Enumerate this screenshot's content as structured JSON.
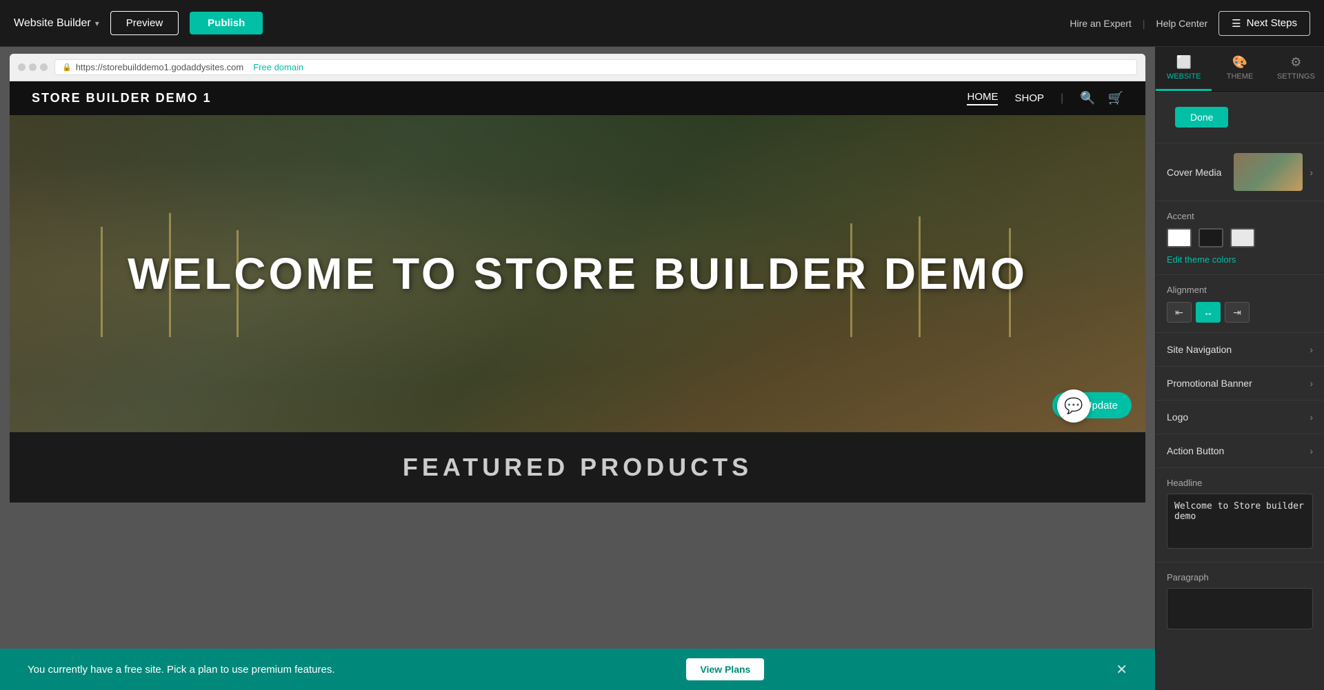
{
  "topBar": {
    "brandTitle": "Website Builder",
    "previewLabel": "Preview",
    "publishLabel": "Publish",
    "hireExpert": "Hire an Expert",
    "helpCenter": "Help Center",
    "nextStepsLabel": "Next Steps"
  },
  "browserChrome": {
    "addressBar": "https://storebuilddemo1.godaddysites.com",
    "freeDomainLabel": "Free domain"
  },
  "sitePreview": {
    "logo": "STORE BUILDER DEMO 1",
    "navHome": "HOME",
    "navShop": "SHOP",
    "heroTitle": "WELCOME TO STORE BUILDER DEMO",
    "updateBtn": "Update",
    "featuredTitle": "FEATURED PRODUCTS"
  },
  "bottomBanner": {
    "message": "You currently have a free site. Pick a plan to use premium features.",
    "viewPlansLabel": "View Plans"
  },
  "rightPanel": {
    "tabs": [
      {
        "id": "website",
        "label": "WEBSITE",
        "icon": "⬜"
      },
      {
        "id": "theme",
        "label": "THEME",
        "icon": "🎨"
      },
      {
        "id": "settings",
        "label": "SETTINGS",
        "icon": "⚙"
      }
    ],
    "doneLabel": "Done",
    "coverMedia": {
      "title": "Cover Media"
    },
    "accent": {
      "label": "Accent",
      "editLabel": "Edit theme colors"
    },
    "alignment": {
      "label": "Alignment",
      "options": [
        "left",
        "center",
        "right"
      ]
    },
    "siteNavigation": {
      "title": "Site Navigation"
    },
    "promotionalBanner": {
      "title": "Promotional Banner"
    },
    "logo": {
      "title": "Logo"
    },
    "actionButton": {
      "title": "Action Button"
    },
    "headline": {
      "label": "Headline",
      "value": "Welcome to Store builder demo"
    },
    "paragraph": {
      "label": "Paragraph"
    }
  }
}
